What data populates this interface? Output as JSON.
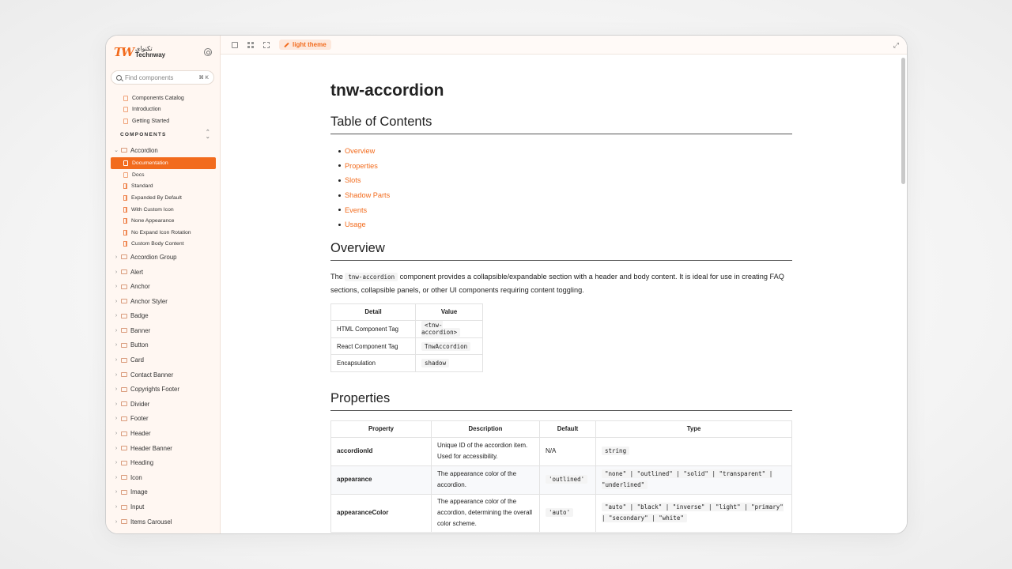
{
  "brand": {
    "mark": "TW",
    "name_ar": "تكنواي",
    "name_en": "Technway"
  },
  "search": {
    "placeholder": "Find components",
    "shortcut": "⌘ K"
  },
  "sidebar": {
    "top_items": [
      "Components Catalog",
      "Introduction",
      "Getting Started"
    ],
    "section_label": "COMPONENTS",
    "accordion": {
      "label": "Accordion",
      "children": [
        "Documentation",
        "Docs",
        "Standard",
        "Expanded By Default",
        "With Custom Icon",
        "None Appearance",
        "No Expand Icon Rotation",
        "Custom Body Content"
      ]
    },
    "folders": [
      "Accordion Group",
      "Alert",
      "Anchor",
      "Anchor Styler",
      "Badge",
      "Banner",
      "Button",
      "Card",
      "Contact Banner",
      "Copyrights Footer",
      "Divider",
      "Footer",
      "Header",
      "Header Banner",
      "Heading",
      "Icon",
      "Image",
      "Input",
      "Items Carousel"
    ]
  },
  "toolbar": {
    "theme_label": "light theme"
  },
  "doc": {
    "title": "tnw-accordion",
    "toc_heading": "Table of Contents",
    "toc": [
      "Overview",
      "Properties",
      "Slots",
      "Shadow Parts",
      "Events",
      "Usage"
    ],
    "overview_heading": "Overview",
    "overview_pre": "The ",
    "overview_code": "tnw-accordion",
    "overview_post": " component provides a collapsible/expandable section with a header and body content. It is ideal for use in creating FAQ sections, collapsible panels, or other UI components requiring content toggling.",
    "detail_table": {
      "headers": [
        "Detail",
        "Value"
      ],
      "rows": [
        [
          "HTML Component Tag",
          "<tnw-accordion>"
        ],
        [
          "React Component Tag",
          "TnwAccordion"
        ],
        [
          "Encapsulation",
          "shadow"
        ]
      ]
    },
    "properties_heading": "Properties",
    "props_table": {
      "headers": [
        "Property",
        "Description",
        "Default",
        "Type"
      ],
      "rows": [
        [
          "accordionId",
          "Unique ID of the accordion item. Used for accessibility.",
          "N/A",
          "string"
        ],
        [
          "appearance",
          "The appearance color of the accordion.",
          "'outlined'",
          "\"none\" | \"outlined\" | \"solid\" | \"transparent\" | \"underlined\""
        ],
        [
          "appearanceColor",
          "The appearance color of the accordion, determining the overall color scheme.",
          "'auto'",
          "\"auto\" | \"black\" | \"inverse\" | \"light\" | \"primary\" | \"secondary\" | \"white\""
        ]
      ]
    }
  },
  "colors": {
    "accent": "#f26b1d",
    "sidebar_bg": "#fff7f2"
  }
}
